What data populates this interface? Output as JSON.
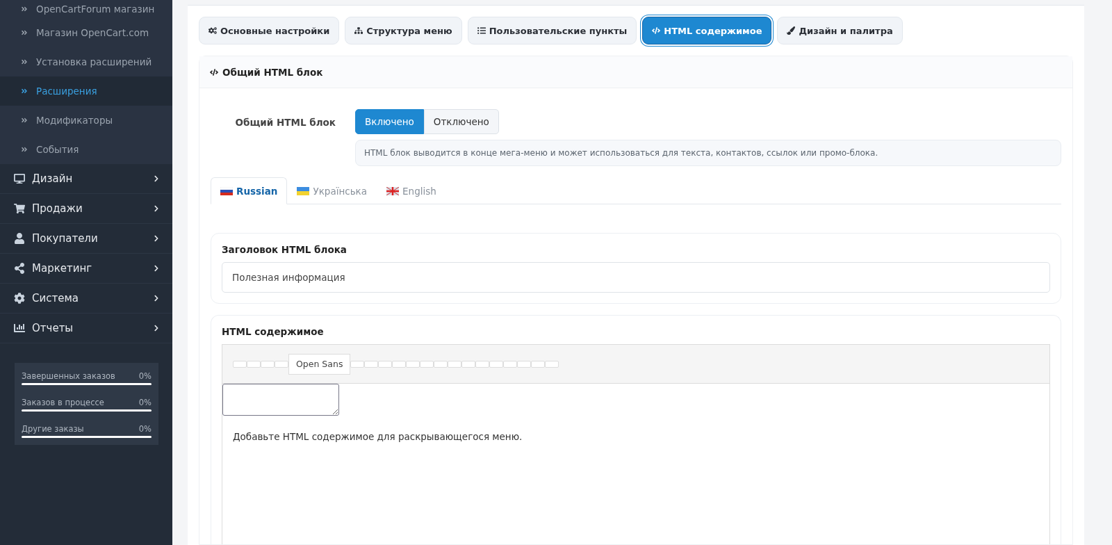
{
  "sidebar": {
    "subitems": [
      {
        "label": "OpenCartForum магазин",
        "selected": false
      },
      {
        "label": "Магазин OpenCart.com",
        "selected": false
      },
      {
        "label": "Установка расширений",
        "selected": false
      },
      {
        "label": "Расширения",
        "selected": true
      },
      {
        "label": "Модификаторы",
        "selected": false
      },
      {
        "label": "События",
        "selected": false
      }
    ],
    "items": [
      {
        "label": "Дизайн",
        "kind": "monitor"
      },
      {
        "label": "Продажи",
        "kind": "cart"
      },
      {
        "label": "Покупатели",
        "kind": "user"
      },
      {
        "label": "Маркетинг",
        "kind": "share"
      },
      {
        "label": "Система",
        "kind": "gear"
      },
      {
        "label": "Отчеты",
        "kind": "chart"
      }
    ],
    "stats": [
      {
        "label": "Завершенных заказов",
        "value": "0%",
        "level": 0
      },
      {
        "label": "Заказов в процессе",
        "value": "0%",
        "level": 0
      },
      {
        "label": "Другие заказы",
        "value": "0%",
        "level": 0
      }
    ]
  },
  "tabs": [
    {
      "label": "Основные настройки",
      "kind": "gears",
      "selected": false
    },
    {
      "label": "Структура меню",
      "kind": "sitemap",
      "selected": false
    },
    {
      "label": "Пользовательские пункты",
      "kind": "list",
      "selected": false
    },
    {
      "label": "HTML содержимое",
      "kind": "code",
      "selected": true
    },
    {
      "label": "Дизайн и палитра",
      "kind": "brush",
      "selected": false
    }
  ],
  "card": {
    "title": "Общий HTML блок",
    "toggle": {
      "label": "Общий HTML блок",
      "options": [
        {
          "label": "Включено",
          "selected": true
        },
        {
          "label": "Отключено",
          "selected": false
        }
      ]
    },
    "hint": "HTML блок выводится в конце мега-меню и может использоваться для текста, контактов, ссылок или промо-блока.",
    "languages": [
      {
        "label": "Russian",
        "kind": "ru",
        "selected": true
      },
      {
        "label": "Українська",
        "kind": "ua",
        "selected": false
      },
      {
        "label": "English",
        "kind": "en",
        "selected": false
      }
    ],
    "heading_field": {
      "label": "Заголовок HTML блока",
      "value": "Полезная информация"
    },
    "editor": {
      "label": "HTML содержимое",
      "font": "Open Sans",
      "content": "Добавьте HTML содержимое для раскрывающегося меню."
    }
  }
}
